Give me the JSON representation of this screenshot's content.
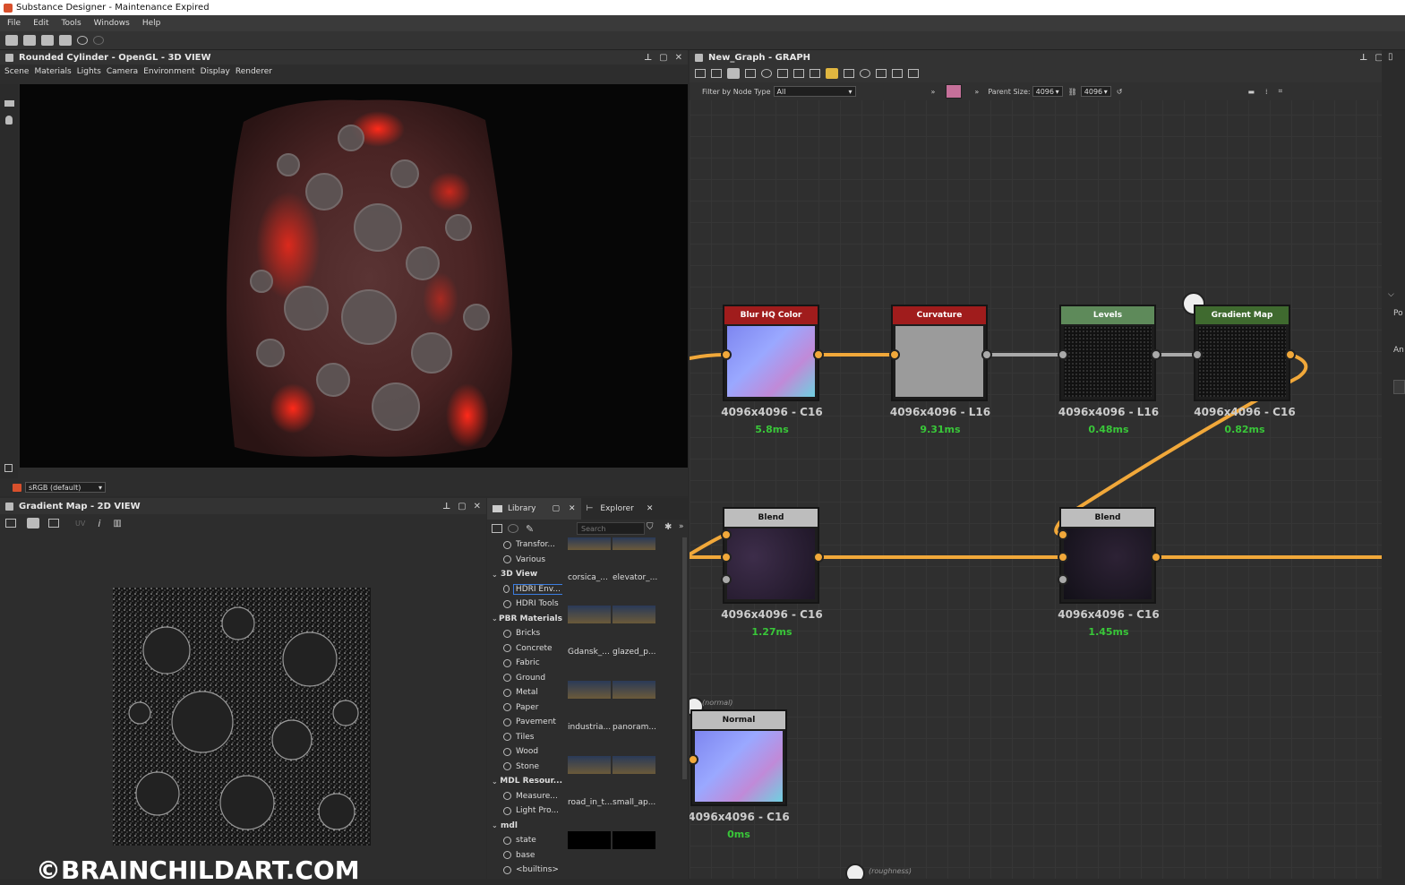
{
  "window_title": "Substance Designer - Maintenance Expired",
  "menu": [
    "File",
    "Edit",
    "Tools",
    "Windows",
    "Help"
  ],
  "view3d": {
    "title": "Rounded Cylinder - OpenGL - 3D VIEW",
    "menu": [
      "Scene",
      "Materials",
      "Lights",
      "Camera",
      "Environment",
      "Display",
      "Renderer"
    ],
    "colorspace": "sRGB (default)"
  },
  "view2d": {
    "title": "Gradient Map - 2D VIEW",
    "uv_label": "UV"
  },
  "library": {
    "tab_library": "Library",
    "tab_explorer": "Explorer",
    "search_placeholder": "Search",
    "tree": [
      {
        "label": "Transfor...",
        "type": "item"
      },
      {
        "label": "Various",
        "type": "item"
      },
      {
        "label": "3D View",
        "type": "cat"
      },
      {
        "label": "HDRI Env...",
        "type": "item",
        "selected": true
      },
      {
        "label": "HDRI Tools",
        "type": "item"
      },
      {
        "label": "PBR Materials",
        "type": "cat"
      },
      {
        "label": "Bricks",
        "type": "item"
      },
      {
        "label": "Concrete",
        "type": "item"
      },
      {
        "label": "Fabric",
        "type": "item"
      },
      {
        "label": "Ground",
        "type": "item"
      },
      {
        "label": "Metal",
        "type": "item"
      },
      {
        "label": "Paper",
        "type": "item"
      },
      {
        "label": "Pavement",
        "type": "item"
      },
      {
        "label": "Tiles",
        "type": "item"
      },
      {
        "label": "Wood",
        "type": "item"
      },
      {
        "label": "Stone",
        "type": "item"
      },
      {
        "label": "MDL Resour...",
        "type": "cat"
      },
      {
        "label": "Measure...",
        "type": "item"
      },
      {
        "label": "Light Pro...",
        "type": "item"
      },
      {
        "label": "mdl",
        "type": "cat"
      },
      {
        "label": "state",
        "type": "item"
      },
      {
        "label": "base",
        "type": "item"
      },
      {
        "label": "<builtins>",
        "type": "item"
      }
    ],
    "thumbs": [
      [
        "corsica_...",
        "elevator_..."
      ],
      [
        "Gdansk_...",
        "glazed_p..."
      ],
      [
        "industria...",
        "panoram..."
      ],
      [
        "road_in_t...",
        "small_ap..."
      ]
    ]
  },
  "graph": {
    "title": "New_Graph - GRAPH",
    "filter_label": "Filter by Node Type",
    "filter_value": "All",
    "parent_size_label": "Parent Size:",
    "parent_size_w": "4096",
    "parent_size_h": "4096",
    "nodes": {
      "blurhq": {
        "title": "Blur HQ Color",
        "res": "4096x4096 - C16",
        "time": "5.8ms",
        "color": "#a01c1c"
      },
      "curvature": {
        "title": "Curvature",
        "res": "4096x4096 - L16",
        "time": "9.31ms",
        "color": "#a01c1c"
      },
      "levels": {
        "title": "Levels",
        "res": "4096x4096 - L16",
        "time": "0.48ms",
        "color": "#5e8a5a"
      },
      "gradientmap": {
        "title": "Gradient Map",
        "res": "4096x4096 - C16",
        "time": "0.82ms",
        "color": "#3f6a2f"
      },
      "blend1": {
        "title": "Blend",
        "res": "4096x4096 - C16",
        "time": "1.27ms",
        "color": "#bdbdbd"
      },
      "blend2": {
        "title": "Blend",
        "res": "4096x4096 - C16",
        "time": "1.45ms",
        "color": "#bdbdbd"
      },
      "normal": {
        "title": "Normal",
        "res": "4096x4096 - C16",
        "time": "0ms",
        "color": "#bdbdbd"
      }
    },
    "output_label_normal": "(normal)",
    "output_label_roughness": "(roughness)"
  },
  "side_panel": {
    "label_po": "Po",
    "label_an": "An"
  },
  "watermark": "©BRAINCHILDART.COM",
  "colors": {
    "accent_orange": "#f1a83a",
    "time_green": "#39c739",
    "node_red": "#a01c1c"
  }
}
